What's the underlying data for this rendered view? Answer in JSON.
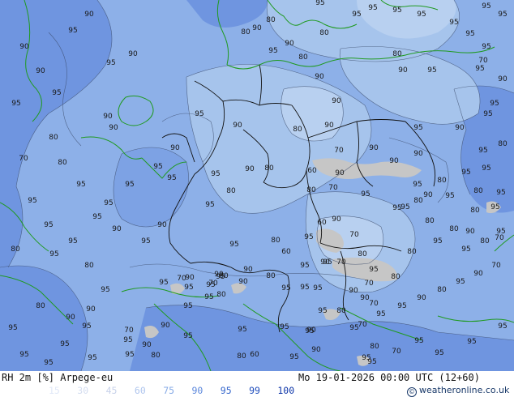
{
  "footer": {
    "title": "RH 2m [%] Arpege-eu",
    "datetime": "Mo 19-01-2026 00:00 UTC (12+60)",
    "credit": "weatheronline.co.uk",
    "legend": [
      {
        "label": "15",
        "color": "#e0e8f8"
      },
      {
        "label": "30",
        "color": "#d4ddf0"
      },
      {
        "label": "45",
        "color": "#c8d2ea"
      },
      {
        "label": "60",
        "color": "#b0c6ee"
      },
      {
        "label": "75",
        "color": "#86aae6"
      },
      {
        "label": "90",
        "color": "#5c88dc"
      },
      {
        "label": "95",
        "color": "#3466cc"
      },
      {
        "label": "99",
        "color": "#1e4cbc"
      },
      {
        "label": "100",
        "color": "#0c34a8"
      }
    ]
  },
  "map": {
    "colors": {
      "humid_95": "#6f95e0",
      "moist_90": "#8db0e8",
      "moderate_80": "#a6c4ec",
      "fairly_dry_70": "#b8d0f0",
      "dry_60": "#c6c6c6",
      "contour": "#3a4a6a",
      "coast": "#1f9a1f",
      "border": "#111111"
    },
    "labels": [
      "95",
      "80",
      "90",
      "80",
      "80",
      "90",
      "95",
      "95",
      "80",
      "90",
      "80",
      "90",
      "90",
      "95",
      "95",
      "70",
      "95",
      "90",
      "80",
      "90",
      "95",
      "90",
      "95",
      "95",
      "90",
      "95",
      "90",
      "80",
      "90",
      "90",
      "70",
      "80",
      "90",
      "95",
      "90",
      "95",
      "95",
      "95",
      "90",
      "80",
      "60",
      "70",
      "90",
      "80",
      "80",
      "80",
      "70",
      "95",
      "95",
      "95",
      "80",
      "95",
      "95",
      "90",
      "90",
      "90",
      "95",
      "95",
      "90",
      "95",
      "80",
      "95",
      "95",
      "80",
      "60",
      "90",
      "80",
      "95",
      "70",
      "60",
      "80",
      "95",
      "70",
      "95",
      "90",
      "95",
      "80",
      "70",
      "80",
      "80",
      "70",
      "95",
      "80",
      "90",
      "70",
      "95",
      "90",
      "90",
      "95",
      "95",
      "95",
      "70",
      "80",
      "95",
      "95",
      "95",
      "95",
      "70",
      "95",
      "90",
      "90",
      "95",
      "95",
      "95",
      "95",
      "80",
      "70",
      "70",
      "90",
      "95",
      "95",
      "95",
      "95",
      "95",
      "95",
      "95",
      "95",
      "90",
      "95",
      "80",
      "60",
      "95",
      "90",
      "95",
      "95",
      "95",
      "95",
      "80",
      "90",
      "95",
      "95",
      "80",
      "70",
      "90",
      "90",
      "95",
      "95",
      "90",
      "80",
      "95",
      "90",
      "70",
      "95",
      "80",
      "95",
      "80",
      "80",
      "80",
      "95",
      "95",
      "80",
      "95",
      "90",
      "95",
      "95",
      "95",
      "95",
      "95",
      "95",
      "95",
      "95",
      "90",
      "90",
      "95",
      "90",
      "95",
      "95",
      "95",
      "95",
      "80",
      "95",
      "80",
      "95",
      "95",
      "90",
      "95",
      "95",
      "90",
      "95",
      "95"
    ]
  }
}
